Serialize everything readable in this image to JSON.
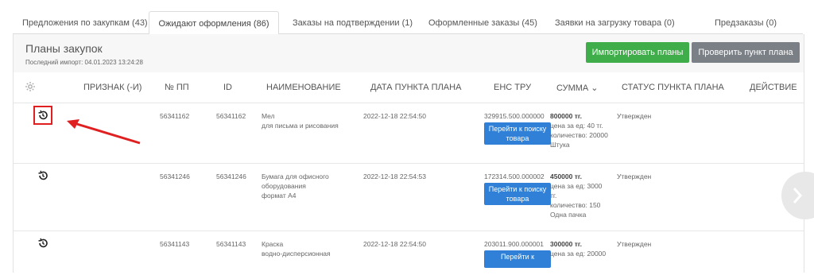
{
  "tabs": [
    {
      "label": "Предложения по закупкам (43)",
      "active": false
    },
    {
      "label": "Ожидают оформления (86)",
      "active": true
    },
    {
      "label": "Заказы на подтверждении (1)",
      "active": false
    },
    {
      "label": "Оформленные заказы (45)",
      "active": false
    },
    {
      "label": "Заявки на загрузку товара (0)",
      "active": false
    },
    {
      "label": "Предзаказы (0)",
      "active": false
    }
  ],
  "panel": {
    "title": "Планы закупок",
    "subtitle": "Последний импорт: 04.01.2023 13:24:28",
    "import_button": "Импортировать планы",
    "check_button": "Проверить пункт плана"
  },
  "columns": {
    "sign": "ПРИЗНАК (-И)",
    "num": "№ ПП",
    "id": "ID",
    "name": "НАИМЕНОВАНИЕ",
    "date": "ДАТА ПУНКТА ПЛАНА",
    "ens": "ЕНС ТРУ",
    "sum": "СУММА ⌄",
    "status": "СТАТУС ПУНКТА ПЛАНА",
    "action": "ДЕЙСТВИЕ"
  },
  "rows": [
    {
      "num": "56341162",
      "id": "56341162",
      "name1": "Мел",
      "name2": "для письма и рисования",
      "name3": "",
      "date": "2022-12-18 22:54:50",
      "ens": "329915.500.000000",
      "ens_btn": "Перейти к поиску товара",
      "sum": "800000 тг.",
      "price": "цена за ед: 40 тг.",
      "qty": "количество: 20000",
      "unit": "Штука",
      "status": "Утвержден"
    },
    {
      "num": "56341246",
      "id": "56341246",
      "name1": "Бумага для офисного",
      "name2": "оборудования",
      "name3": "формат А4",
      "date": "2022-12-18 22:54:53",
      "ens": "172314.500.000002",
      "ens_btn": "Перейти к поиску товара",
      "sum": "450000 тг.",
      "price": "цена за ед: 3000 тг.",
      "qty": "количество: 150",
      "unit": "Одна пачка",
      "status": "Утвержден"
    },
    {
      "num": "56341143",
      "id": "56341143",
      "name1": "Краска",
      "name2": "водно-дисперсионная",
      "name3": "",
      "date": "2022-12-18 22:54:50",
      "ens": "203011.900.000001",
      "ens_btn": "Перейти к",
      "sum": "300000 тг.",
      "price": "цена за ед: 20000",
      "qty": "",
      "unit": "",
      "status": "Утвержден"
    }
  ],
  "icons": {
    "settings": "gear-icon",
    "history": "history-icon",
    "next": "chevron-right-icon",
    "annotation": "red-arrow"
  },
  "colors": {
    "green": "#3fae4a",
    "gray": "#7b8086",
    "blue": "#2f80d6",
    "annotation": "#e02020"
  }
}
